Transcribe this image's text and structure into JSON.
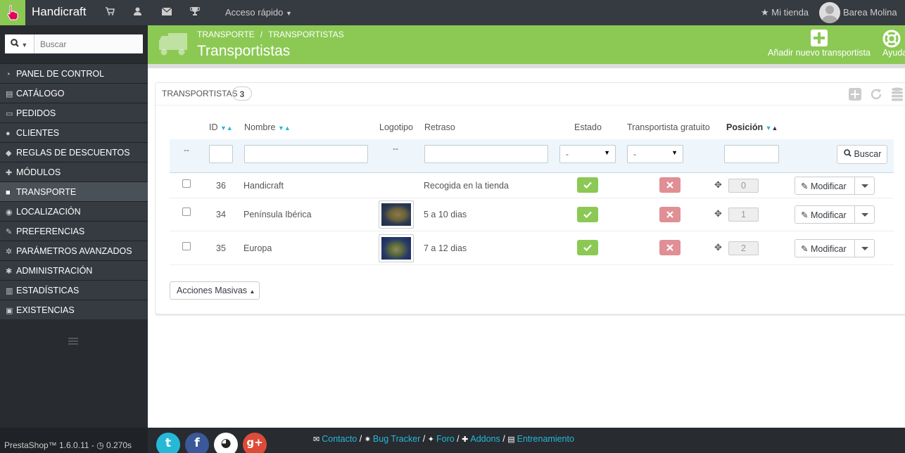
{
  "topbar": {
    "brand": "Handicraft",
    "quick_access": "Acceso rápido",
    "my_store": "Mi tienda",
    "user": "Barea Molina",
    "icons": [
      "cart-icon",
      "user-icon",
      "envelope-icon",
      "trophy-icon"
    ]
  },
  "sidebar": {
    "search_placeholder": "Buscar",
    "items": [
      {
        "label": "PANEL DE CONTROL",
        "icon": "dashboard-icon"
      },
      {
        "label": "CATÁLOGO",
        "icon": "book-icon"
      },
      {
        "label": "PEDIDOS",
        "icon": "credit-card-icon"
      },
      {
        "label": "CLIENTES",
        "icon": "users-icon"
      },
      {
        "label": "REGLAS DE DESCUENTOS",
        "icon": "tags-icon"
      },
      {
        "label": "MÓDULOS",
        "icon": "puzzle-icon"
      },
      {
        "label": "TRANSPORTE",
        "icon": "truck-icon",
        "active": true
      },
      {
        "label": "LOCALIZACIÓN",
        "icon": "globe-icon"
      },
      {
        "label": "PREFERENCIAS",
        "icon": "wrench-icon"
      },
      {
        "label": "PARÁMETROS AVANZADOS",
        "icon": "cogs-icon"
      },
      {
        "label": "ADMINISTRACIÓN",
        "icon": "cog-icon"
      },
      {
        "label": "ESTADÍSTICAS",
        "icon": "bar-chart-icon"
      },
      {
        "label": "EXISTENCIAS",
        "icon": "archive-icon"
      }
    ]
  },
  "header": {
    "breadcrumb": [
      "TRANSPORTE",
      "TRANSPORTISTAS"
    ],
    "title": "Transportistas",
    "add_label": "Añadir nuevo transportista",
    "help_label": "Ayuda"
  },
  "panel": {
    "title": "TRANSPORTISTAS",
    "count": "3",
    "columns": {
      "id": "ID",
      "name": "Nombre",
      "logo": "Logotipo",
      "delay": "Retraso",
      "status": "Estado",
      "free": "Transportista gratuito",
      "position": "Posición"
    },
    "filters": {
      "dash": "--",
      "status_selected": "-",
      "free_selected": "-",
      "search_button": "Buscar"
    },
    "rows": [
      {
        "id": "36",
        "name": "Handicraft",
        "delay": "Recogida en la tienda",
        "active": true,
        "free": false,
        "position": "0",
        "logo": "none"
      },
      {
        "id": "34",
        "name": "Península Ibérica",
        "delay": "5 a 10 dias",
        "active": true,
        "free": false,
        "position": "1",
        "logo": "iberia-map"
      },
      {
        "id": "35",
        "name": "Europa",
        "delay": "7 a 12 dias",
        "active": true,
        "free": false,
        "position": "2",
        "logo": "europe-map"
      }
    ],
    "edit_label": "Modificar",
    "bulk_label": "Acciones Masivas"
  },
  "footer": {
    "version": "PrestaShop™ 1.6.0.11 - ",
    "time": "0.270s",
    "links": [
      "Contacto",
      "Bug Tracker",
      "Foro",
      "Addons",
      "Entrenamiento"
    ],
    "separators": "/"
  },
  "colors": {
    "accent": "#8bc954",
    "link": "#25b9d7",
    "dark": "#363a41",
    "danger": "#e08f95"
  }
}
